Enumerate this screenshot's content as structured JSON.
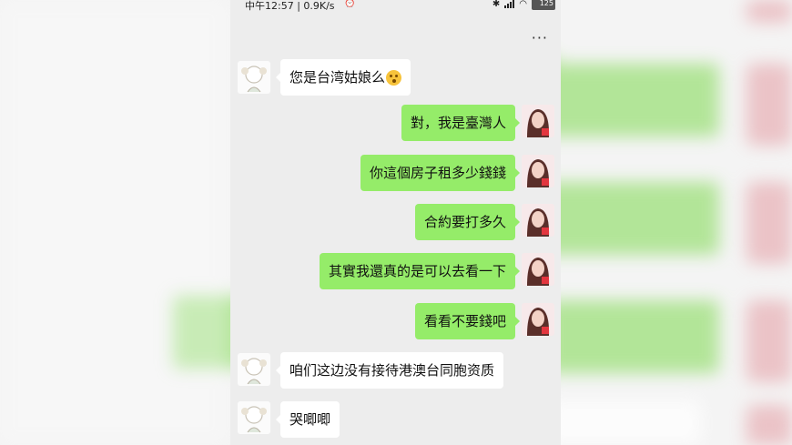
{
  "status_bar": {
    "left_text": "中午12:57 | 0.9K/s",
    "alarm_icon": "alarm-icon",
    "bluetooth_icon": "bluetooth-icon",
    "signal_icon": "signal-icon",
    "wifi_icon": "wifi-icon",
    "battery_level": "125"
  },
  "header": {
    "more_label": "···"
  },
  "messages": [
    {
      "side": "in",
      "text": "您是台湾姑娘么",
      "emoji": "flushed-face"
    },
    {
      "side": "out",
      "text": "對，我是臺灣人"
    },
    {
      "side": "out",
      "text": "你這個房子租多少錢錢"
    },
    {
      "side": "out",
      "text": "合約要打多久"
    },
    {
      "side": "out",
      "text": "其實我還真的是可以去看一下"
    },
    {
      "side": "out",
      "text": "看看不要錢吧"
    },
    {
      "side": "in",
      "text": "咱们这边没有接待港澳台同胞资质"
    },
    {
      "side": "in",
      "text": "哭唧唧"
    }
  ],
  "colors": {
    "incoming_bubble": "#ffffff",
    "outgoing_bubble": "#95ec69",
    "chat_background": "#ededed"
  }
}
